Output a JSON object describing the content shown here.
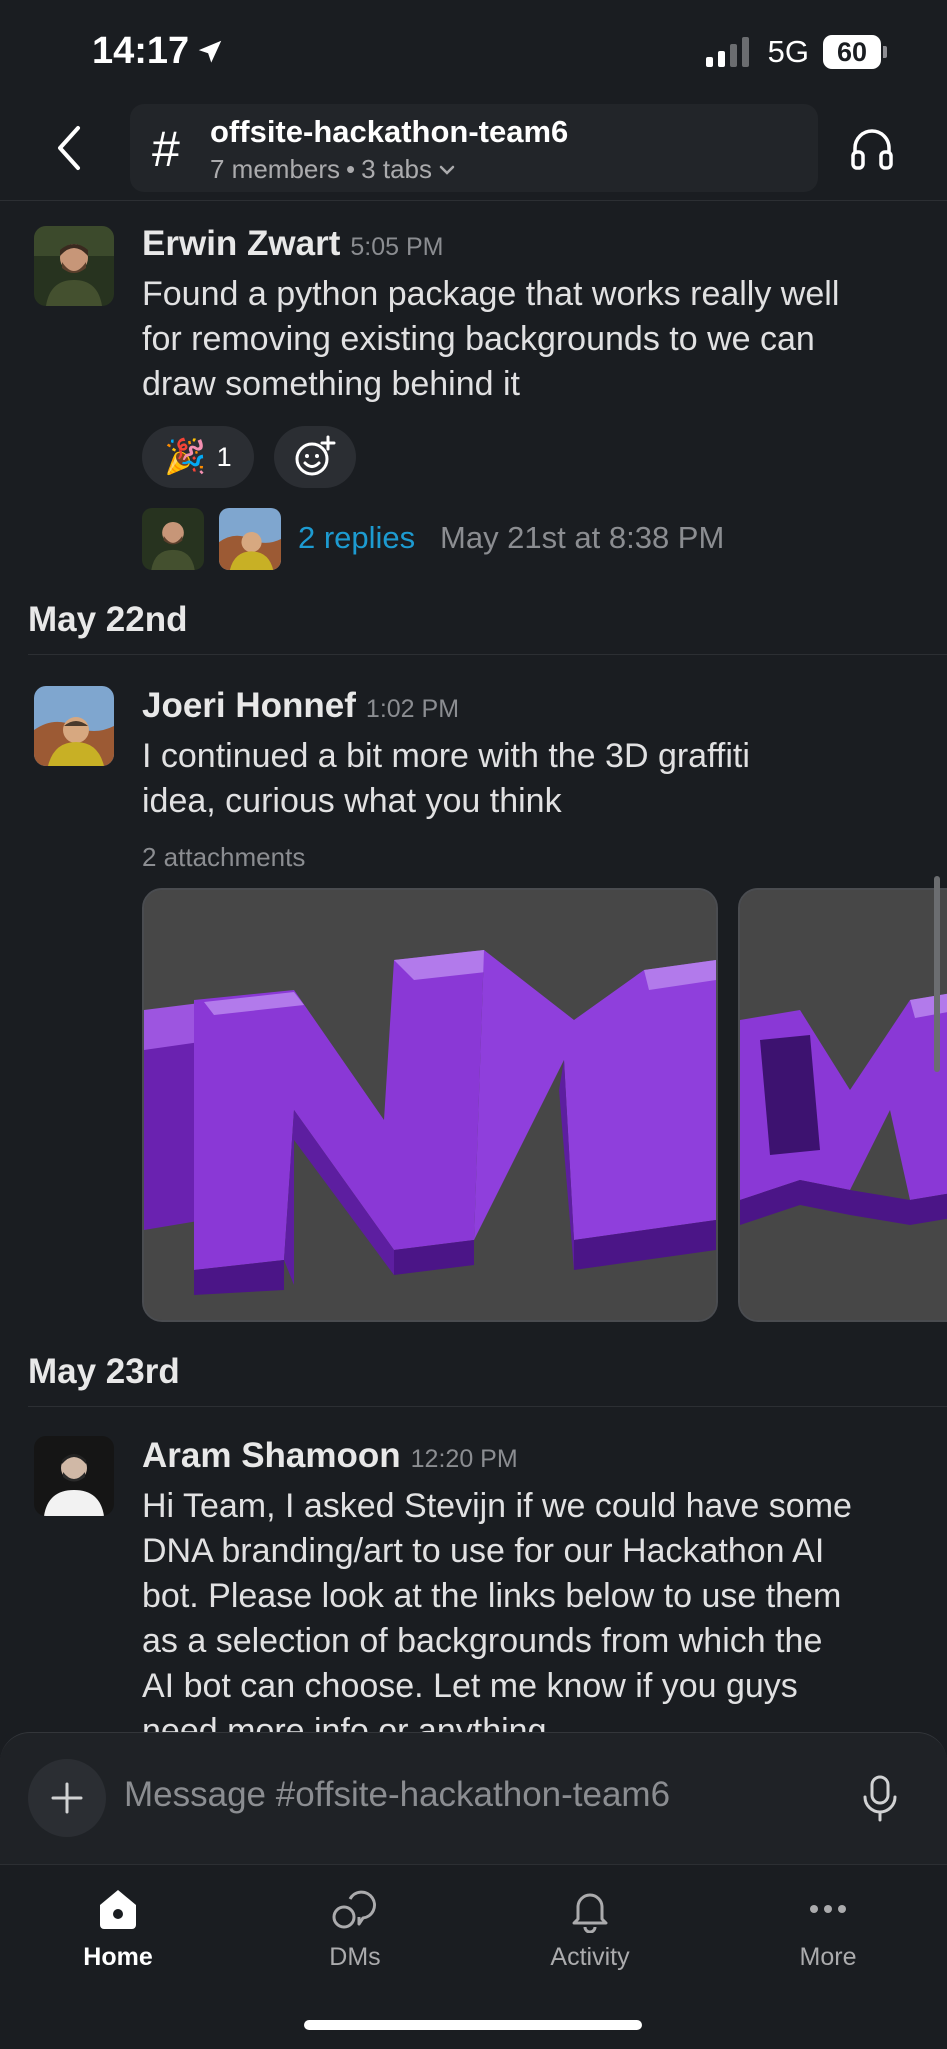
{
  "status_bar": {
    "time": "14:17",
    "network": "5G",
    "battery": "60"
  },
  "header": {
    "channel_name": "offsite-hackathon-team6",
    "members": "7 members",
    "separator": "•",
    "tabs": "3 tabs"
  },
  "messages": [
    {
      "sender": "Erwin Zwart",
      "time": "5:05 PM",
      "lines": [
        "Found a python package that works really well",
        "for removing existing backgrounds to we can",
        "draw something behind it"
      ],
      "reaction": {
        "emoji": "🎉",
        "count": "1"
      },
      "thread": {
        "replies": "2 replies",
        "last_reply": "May 21st at 8:38 PM"
      }
    },
    {
      "sender": "Joeri Honnef",
      "time": "1:02 PM",
      "lines": [
        "I continued a bit more with the 3D graffiti",
        "idea, curious what you think"
      ],
      "attachments_label": "2 attachments"
    },
    {
      "sender": "Aram Shamoon",
      "time": "12:20 PM",
      "lines": [
        "Hi Team, I asked Stevijn if we could have some",
        "DNA branding/art to use for our Hackathon AI",
        "bot. Please look at the links below to use them",
        "as a selection of backgrounds from which the",
        "AI bot can choose. Let me know if you guys",
        "need more info or anything"
      ]
    }
  ],
  "dates": [
    "May 22nd",
    "May 23rd"
  ],
  "composer": {
    "placeholder": "Message #offsite-hackathon-team6"
  },
  "tabbar": [
    {
      "label": "Home",
      "icon": "home-icon",
      "active": true
    },
    {
      "label": "DMs",
      "icon": "dms-icon",
      "active": false
    },
    {
      "label": "Activity",
      "icon": "bell-icon",
      "active": false
    },
    {
      "label": "More",
      "icon": "more-icon",
      "active": false
    }
  ],
  "colors": {
    "background": "#1a1d21",
    "link": "#1d9bd1",
    "purple_render": "#8a38d6"
  }
}
